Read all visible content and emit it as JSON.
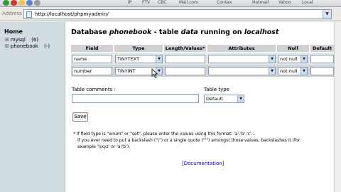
{
  "browser": {
    "toolbar_labels": [
      "IP",
      "FTV",
      "CBC",
      "Mail.com",
      "Contax",
      "Hotmail",
      "Yahoo",
      "Local"
    ],
    "address_label": "Address",
    "url": "http://localhost/phpmyadmin/"
  },
  "sidebar": {
    "home": "Home",
    "databases": [
      {
        "name": "mysql",
        "count": "(6)"
      },
      {
        "name": "phonebook",
        "count": "(-)"
      }
    ]
  },
  "main": {
    "heading_prefix": "Database ",
    "db_name": "phonebook",
    "heading_mid": " - table ",
    "table_name": "data",
    "heading_suffix": " running on ",
    "host": "localhost",
    "columns": [
      "Field",
      "Type",
      "Length/Values*",
      "Attributes",
      "Null",
      "Default"
    ],
    "rows": [
      {
        "field": "name",
        "type": "TINYTEXT",
        "length": "",
        "attributes": "",
        "null": "not null"
      },
      {
        "field": "number",
        "type": "TINYINT",
        "length": "",
        "attributes": "",
        "null": "not null"
      }
    ],
    "table_comments_label": "Table comments :",
    "table_type_label": "Table type",
    "table_type_value": "Default",
    "save_label": "Save",
    "note_lines": [
      "* If field type is \"enum\" or \"set\", please enter the values using this format: 'a','b','c'...",
      "If you ever need to put a backslash (\"\\\") or a single quote (\"'\") amongst those values, backslashes it (for",
      "example '\\\\xyz' or 'a\\'b')."
    ],
    "documentation_label": "[Documentation]"
  }
}
